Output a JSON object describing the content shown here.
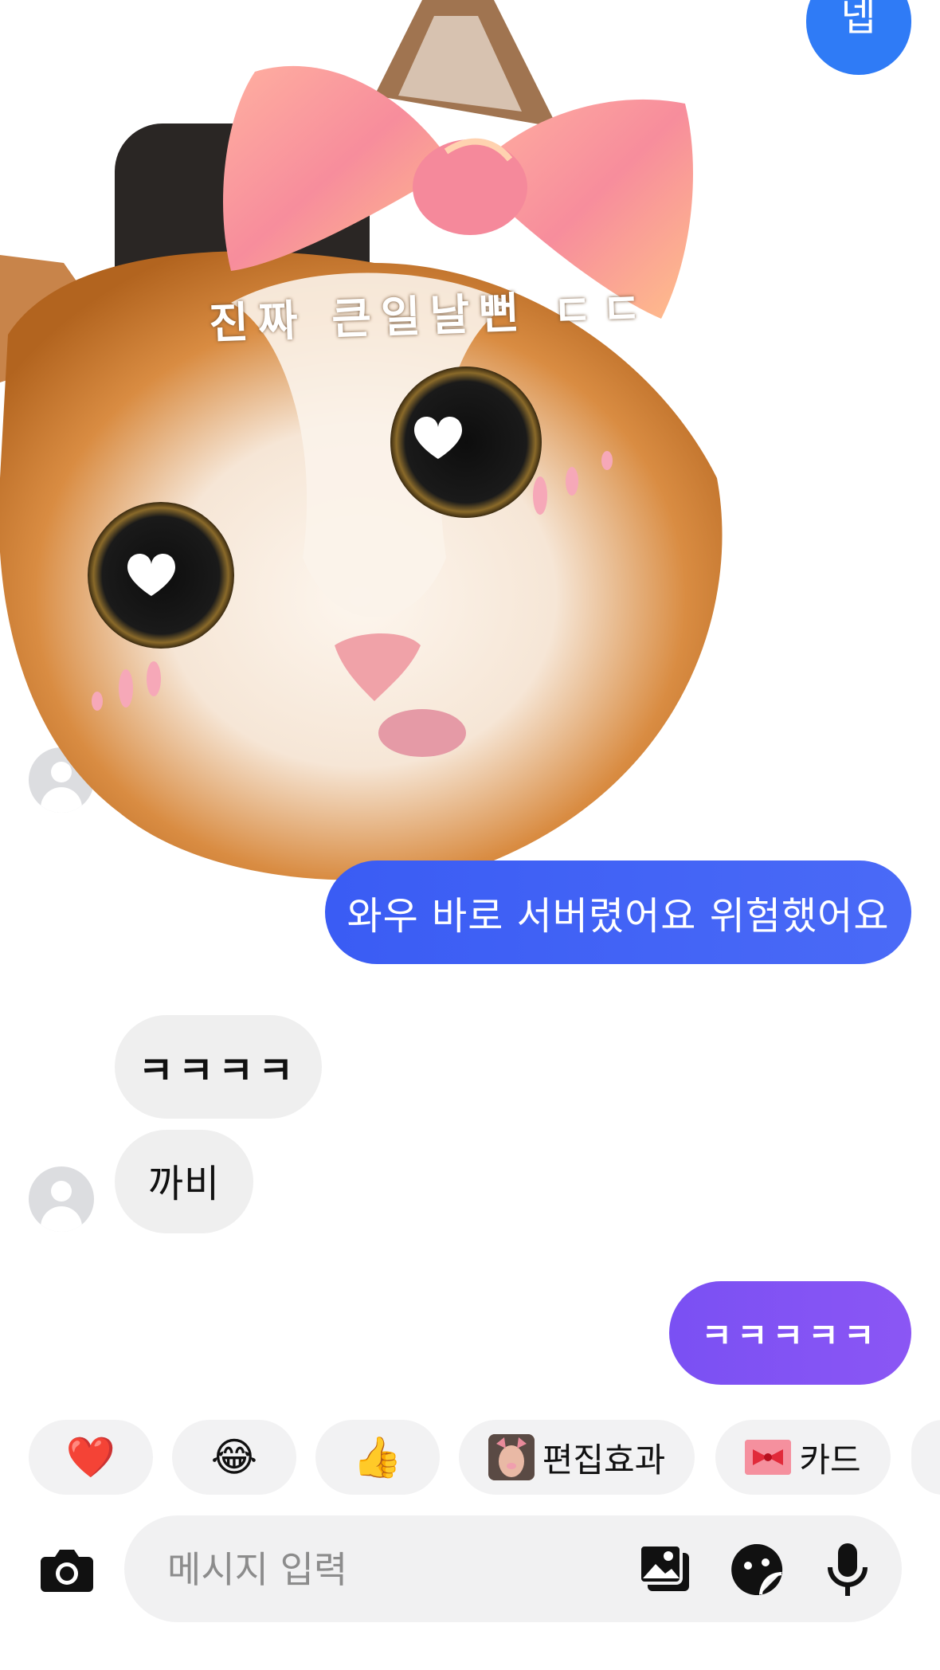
{
  "messages": {
    "top_sent": "넵",
    "sticker_caption": "진짜 큰일날뻔 ㄷㄷ",
    "sent_1": "와우 바로 서버렸어요 위험했어요",
    "recv_1": "ㅋㅋㅋㅋ",
    "recv_2": "까비",
    "sent_2": "ㅋㅋㅋㅋㅋ"
  },
  "quick_replies": [
    {
      "icon": "heart-emoji",
      "glyph": "❤️"
    },
    {
      "icon": "tears-of-joy-emoji",
      "glyph": "😂"
    },
    {
      "icon": "thumbs-up-emoji",
      "glyph": "👍"
    },
    {
      "icon": "face-filter-thumbnail",
      "label": "편집효과"
    },
    {
      "icon": "ribbon-card-icon",
      "label": "카드"
    }
  ],
  "composer": {
    "placeholder": "메시지 입력",
    "icons": [
      "camera-icon",
      "gallery-icon",
      "sticker-icon",
      "mic-icon"
    ]
  },
  "colors": {
    "sent_blue": "#3d62f5",
    "sent_purple": "#7b4df4",
    "received_bg": "#efefef",
    "top_bubble": "#2f7bf6"
  }
}
